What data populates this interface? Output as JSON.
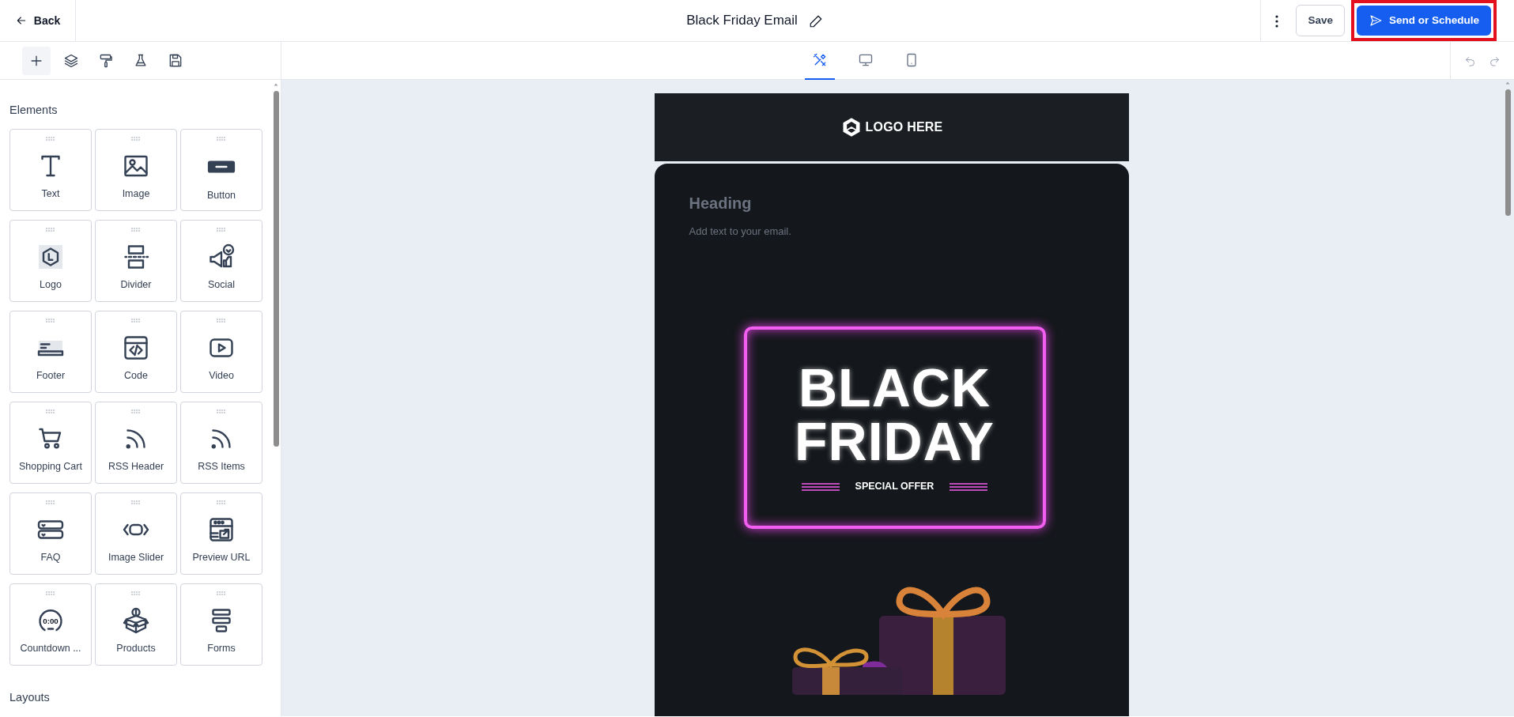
{
  "header": {
    "back": "Back",
    "title": "Black Friday Email",
    "save": "Save",
    "send": {
      "label": "Send or Schedule",
      "highlighted": true
    }
  },
  "tools": [
    {
      "kind": "add",
      "selected": true
    },
    {
      "kind": "layers",
      "selected": false
    },
    {
      "kind": "style",
      "selected": false
    },
    {
      "kind": "test",
      "selected": false
    },
    {
      "kind": "save",
      "selected": false
    }
  ],
  "view_modes": [
    {
      "kind": "editor",
      "selected": true
    },
    {
      "kind": "desktop",
      "selected": false
    },
    {
      "kind": "mobile",
      "selected": false
    }
  ],
  "history": [
    {
      "kind": "undo",
      "disabled": true
    },
    {
      "kind": "redo",
      "disabled": true
    }
  ],
  "sidebar": {
    "sections": [
      {
        "title": "Elements",
        "items": [
          {
            "label": "Text",
            "kind": "text"
          },
          {
            "label": "Image",
            "kind": "image"
          },
          {
            "label": "Button",
            "kind": "button"
          },
          {
            "label": "Logo",
            "kind": "logo"
          },
          {
            "label": "Divider",
            "kind": "divider"
          },
          {
            "label": "Social",
            "kind": "social"
          },
          {
            "label": "Footer",
            "kind": "footer"
          },
          {
            "label": "Code",
            "kind": "code"
          },
          {
            "label": "Video",
            "kind": "video"
          },
          {
            "label": "Shopping Cart",
            "kind": "cart"
          },
          {
            "label": "RSS Header",
            "kind": "rss"
          },
          {
            "label": "RSS Items",
            "kind": "rss"
          },
          {
            "label": "FAQ",
            "kind": "faq"
          },
          {
            "label": "Image Slider",
            "kind": "slider"
          },
          {
            "label": "Preview URL",
            "kind": "preview"
          },
          {
            "label": "Countdown ...",
            "kind": "countdown",
            "icon_text": "0:00"
          },
          {
            "label": "Products",
            "kind": "products"
          },
          {
            "label": "Forms",
            "kind": "forms"
          }
        ]
      },
      {
        "title": "Layouts"
      }
    ]
  },
  "email": {
    "logo": "LOGO HERE",
    "heading": "Heading",
    "body": "Add text to your email.",
    "banner": {
      "lines": [
        "BLACK",
        "FRIDAY"
      ],
      "subtitle": "SPECIAL OFFER"
    }
  }
}
